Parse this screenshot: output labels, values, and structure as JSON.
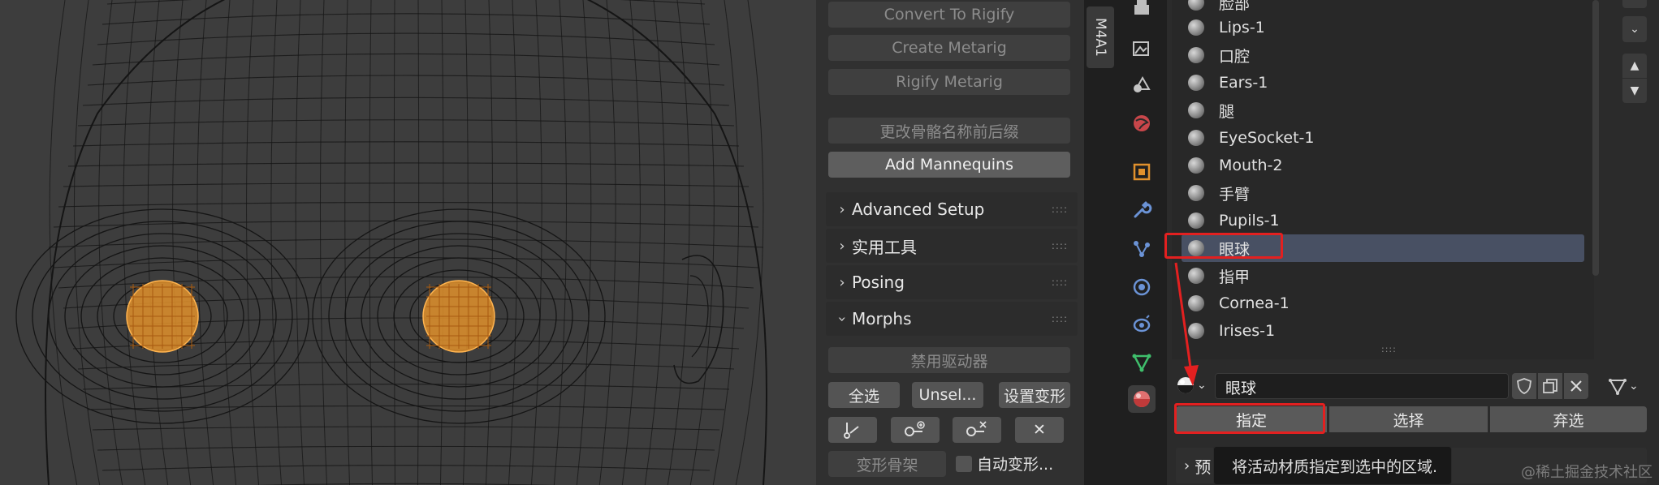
{
  "side_tab": {
    "label": "M4A1"
  },
  "n_panel": {
    "buttons_top": [
      "Convert To Rigify",
      "Create Metarig",
      "Rigify Metarig",
      "更改骨骼名称前后缀",
      "Add Mannequins"
    ],
    "sections": [
      "Advanced Setup",
      "实用工具",
      "Posing",
      "Morphs"
    ],
    "morphs": {
      "disable_drivers": "禁用驱动器",
      "select_all": "全选",
      "unselect": "Unsel...",
      "set_shape": "设置变形",
      "close_symbol": "✕",
      "shape_bones": "变形骨架",
      "auto_shape": "自动变形..."
    }
  },
  "material_list": {
    "items": [
      "脸部",
      "Lips-1",
      "口腔",
      "Ears-1",
      "腿",
      "EyeSocket-1",
      "Mouth-2",
      "手臂",
      "Pupils-1",
      "眼球",
      "指甲",
      "Cornea-1",
      "Irises-1"
    ],
    "selected": "眼球"
  },
  "material_slot": {
    "name": "眼球"
  },
  "assign_row": {
    "assign": "指定",
    "select": "选择",
    "deselect": "弃选"
  },
  "tooltip": {
    "text": "将活动材质指定到选中的区域."
  },
  "preview_section": {
    "label": "预"
  },
  "watermark": "@稀土掘金技术社区",
  "colors": {
    "highlight_red": "#e32020",
    "selection_orange": "#e0902c",
    "selected_row": "#485063"
  }
}
